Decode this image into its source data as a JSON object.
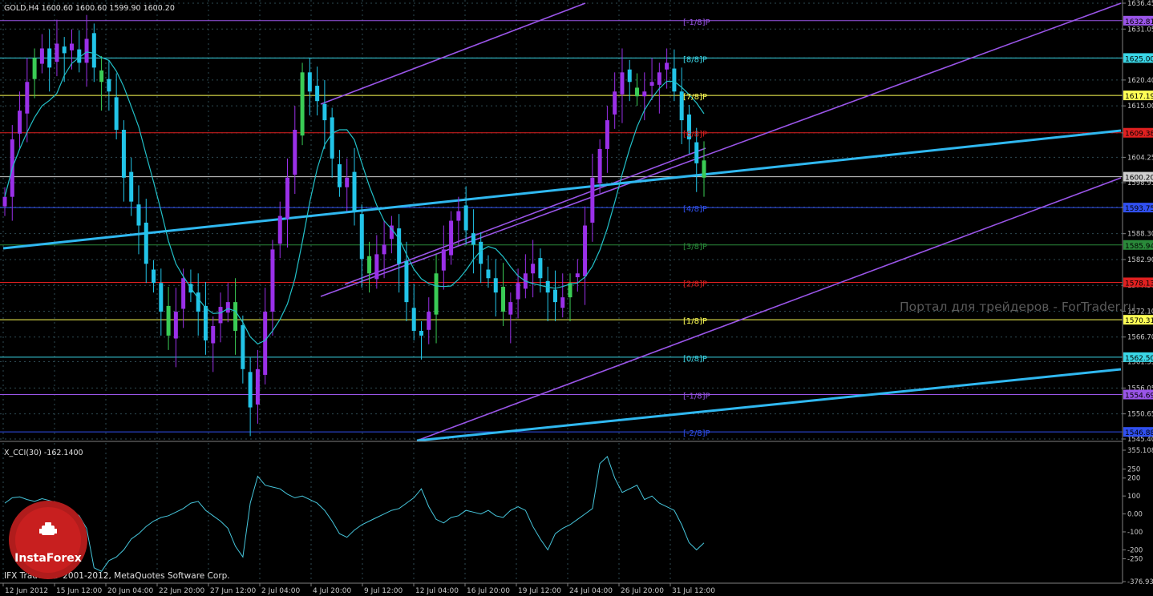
{
  "header": {
    "symbol_info": "GOLD,H4  1600.60 1600.60 1599.90 1600.20",
    "cci_label": "X_CCI(30) -162.1400",
    "copyright": "IFX Trader, © 2001-2012, MetaQuotes Software Corp.",
    "watermark": "Портал для трейдеров - ForTrader.ru",
    "logo_text": "InstaForex"
  },
  "colors": {
    "background": "#000000",
    "bull_candle": "#9a30e8",
    "bear_candle": "#22c4e8",
    "green_candle": "#3acc55",
    "ma": "#22c0c8",
    "channel": "#9a55e8",
    "trendline": "#30b8f0",
    "cci": "#46c6dc"
  },
  "chart_data": [
    {
      "type": "candlestick",
      "title": "GOLD,H4",
      "ylim": [
        1545.4,
        1636.45
      ],
      "y_ticks": [
        "1636.45",
        "1631.05",
        "1625.00",
        "1620.40",
        "1615.00",
        "1609.35",
        "1604.25",
        "1598.95",
        "1593.85",
        "1588.30",
        "1582.90",
        "1577.50",
        "1572.10",
        "1566.70",
        "1561.55",
        "1556.05",
        "1550.65",
        "1545.40"
      ],
      "x_labels": [
        "12 Jun 2012",
        "15 Jun 12:00",
        "20 Jun 04:00",
        "22 Jun 20:00",
        "27 Jun 12:00",
        "2 Jul 04:00",
        "4 Jul 20:00",
        "9 Jul 12:00",
        "12 Jul 04:00",
        "16 Jul 20:00",
        "19 Jul 12:00",
        "24 Jul 04:00",
        "26 Jul 20:00",
        "31 Jul 12:00"
      ],
      "close_path": [
        1596,
        1608,
        1614,
        1620,
        1625,
        1627,
        1623,
        1628,
        1626,
        1628,
        1624,
        1629,
        1623,
        1620,
        1618,
        1610,
        1600,
        1595,
        1590,
        1582,
        1578,
        1572,
        1567,
        1572,
        1579,
        1576,
        1572,
        1566,
        1569,
        1573,
        1574,
        1568,
        1560,
        1552,
        1560,
        1572,
        1585,
        1592,
        1600,
        1610,
        1622,
        1618,
        1616,
        1612,
        1604,
        1598,
        1600,
        1593,
        1583,
        1580,
        1584,
        1586,
        1590,
        1582,
        1574,
        1568,
        1567,
        1572,
        1580,
        1585,
        1591,
        1593,
        1589,
        1586,
        1582,
        1579,
        1576,
        1572,
        1574,
        1578,
        1580,
        1582,
        1579,
        1576,
        1574,
        1575,
        1578,
        1580,
        1590,
        1600,
        1606,
        1612,
        1618,
        1622,
        1620,
        1617,
        1618,
        1620,
        1622,
        1624,
        1618,
        1612,
        1608,
        1603,
        1600
      ],
      "ma_period_note": "",
      "horizontal_levels": [
        {
          "label": "[-1/8]P",
          "value": 1632.8,
          "color": "#9a55e8",
          "tag": "1632.81"
        },
        {
          "label": "[8/8]P",
          "value": 1625.0,
          "color": "#3ad6e6",
          "tag": "1625.00"
        },
        {
          "label": "[7/8]P",
          "value": 1617.19,
          "color": "#ffff55",
          "tag": "1617.19"
        },
        {
          "label": "[6/8]P",
          "value": 1609.38,
          "color": "#e02020",
          "tag": "1609.38"
        },
        {
          "label": "",
          "value": 1600.2,
          "color": "#cfcfcf",
          "tag": "1600.20"
        },
        {
          "label": "[4/8]P",
          "value": 1593.75,
          "color": "#3050f0",
          "tag": "1593.75"
        },
        {
          "label": "[3/8]P",
          "value": 1585.94,
          "color": "#2a8a3a",
          "tag": "1585.94"
        },
        {
          "label": "[2/8]P",
          "value": 1578.13,
          "color": "#e02020",
          "tag": "1578.13"
        },
        {
          "label": "[1/8]P",
          "value": 1570.31,
          "color": "#ffff55",
          "tag": "1570.31"
        },
        {
          "label": "[0/8]P",
          "value": 1562.5,
          "color": "#3ad6e6",
          "tag": "1562.50"
        },
        {
          "label": "[-1/8]P",
          "value": 1554.69,
          "color": "#9a55e8",
          "tag": "1554.69"
        },
        {
          "label": "[-2/8]P",
          "value": 1546.88,
          "color": "#3050f0",
          "tag": "1546.88"
        }
      ]
    },
    {
      "type": "line",
      "title": "X_CCI(30) -162.1400",
      "ylim": [
        -376.931,
        355.108
      ],
      "y_ticks": [
        "355.108",
        "250",
        "200",
        "100",
        "0.00",
        "-100",
        "-200",
        "-250",
        "-376.931"
      ],
      "values": [
        60,
        90,
        95,
        80,
        70,
        85,
        75,
        60,
        40,
        20,
        -10,
        -80,
        -300,
        -320,
        -260,
        -240,
        -200,
        -140,
        -110,
        -70,
        -40,
        -20,
        -10,
        10,
        30,
        60,
        70,
        20,
        -10,
        -40,
        -80,
        -180,
        -240,
        60,
        210,
        160,
        150,
        140,
        110,
        90,
        100,
        80,
        60,
        20,
        -40,
        -110,
        -130,
        -90,
        -60,
        -40,
        -20,
        0,
        20,
        30,
        60,
        90,
        140,
        40,
        -30,
        -50,
        -20,
        -10,
        20,
        10,
        0,
        20,
        -10,
        -20,
        20,
        40,
        20,
        -70,
        -140,
        -200,
        -110,
        -80,
        -60,
        -30,
        0,
        30,
        280,
        320,
        200,
        120,
        140,
        160,
        80,
        100,
        60,
        40,
        20,
        -60,
        -160,
        -200,
        -162
      ]
    }
  ]
}
